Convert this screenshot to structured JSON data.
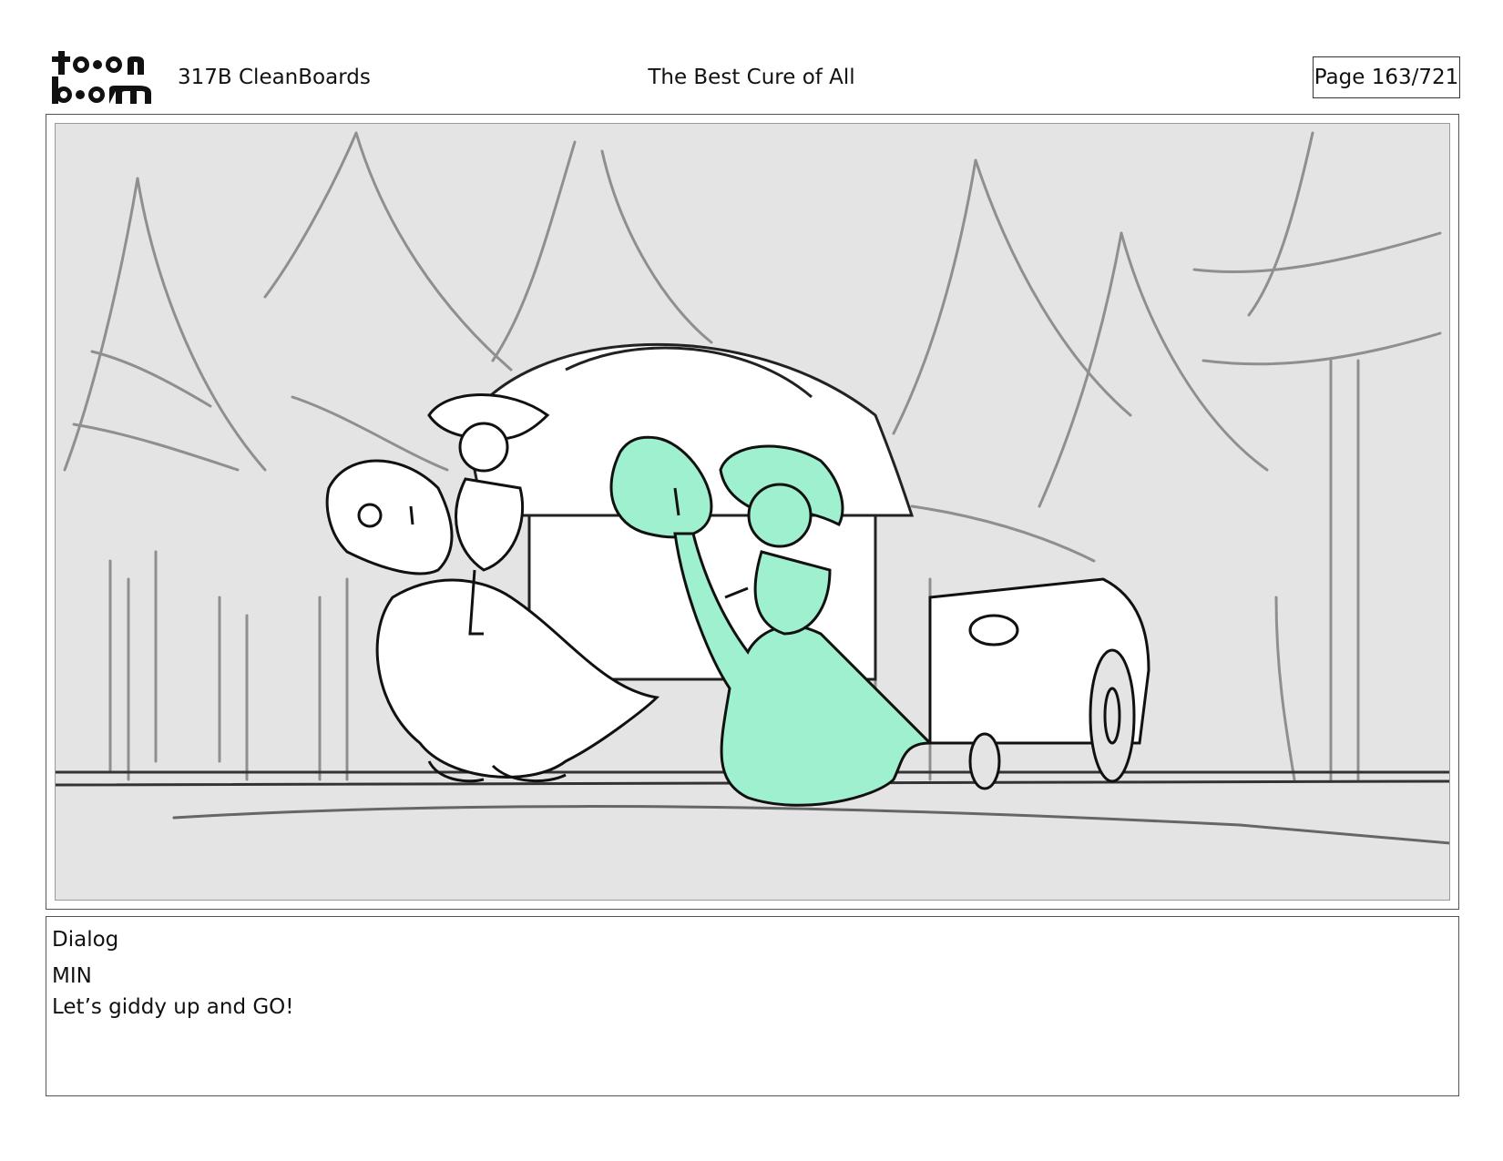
{
  "header": {
    "logo_text": "toon boom",
    "project": "317B  CleanBoards",
    "episode_title": "The Best Cure of All",
    "page": "Page 163/721"
  },
  "panel": {
    "highlight_color": "#9ff0cf",
    "background_color": "#e4e4e4"
  },
  "dialog": {
    "heading": "Dialog",
    "speaker": "MIN",
    "line": "Let’s giddy up and GO!"
  }
}
